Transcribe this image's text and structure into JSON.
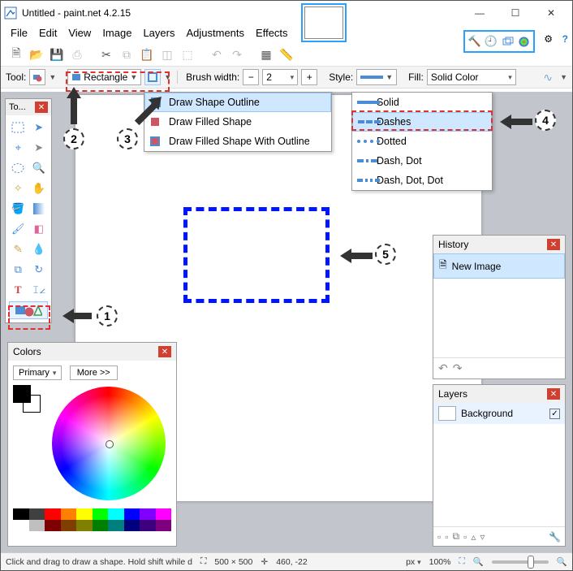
{
  "title": "Untitled - paint.net 4.2.15",
  "menubar": {
    "file": "File",
    "edit": "Edit",
    "view": "View",
    "image": "Image",
    "layers": "Layers",
    "adjustments": "Adjustments",
    "effects": "Effects"
  },
  "toolbar2": {
    "tool_label": "Tool:",
    "shape_picker": "Rectangle",
    "brush_width_label": "Brush width:",
    "brush_width_value": "2",
    "style_label": "Style:",
    "fill_label": "Fill:",
    "fill_value": "Solid Color"
  },
  "shape_menu": {
    "i0": "Draw Shape Outline",
    "i1": "Draw Filled Shape",
    "i2": "Draw Filled Shape With Outline"
  },
  "style_menu": {
    "i0": "Solid",
    "i1": "Dashes",
    "i2": "Dotted",
    "i3": "Dash, Dot",
    "i4": "Dash, Dot, Dot"
  },
  "toolbox": {
    "title": "To..."
  },
  "colors": {
    "title": "Colors",
    "primary": "Primary",
    "more": "More >>"
  },
  "history": {
    "title": "History",
    "item0": "New Image"
  },
  "layers": {
    "title": "Layers",
    "item0": "Background"
  },
  "status": {
    "hint": "Click and drag to draw a shape. Hold shift while drawing to...",
    "size": "500 × 500",
    "pos": "460,  -22",
    "unit": "px",
    "zoom": "100%"
  },
  "callouts": {
    "c1": "1",
    "c2": "2",
    "c3": "3",
    "c4": "4",
    "c5": "5"
  },
  "swatches": [
    "#000",
    "#404040",
    "#ff0000",
    "#ff7f00",
    "#ffff00",
    "#00ff00",
    "#00ffff",
    "#0000ff",
    "#7f00ff",
    "#ff00ff",
    "#fff",
    "#bfbfbf",
    "#7f0000",
    "#7f3f00",
    "#7f7f00",
    "#007f00",
    "#007f7f",
    "#00007f",
    "#3f007f",
    "#7f007f"
  ]
}
